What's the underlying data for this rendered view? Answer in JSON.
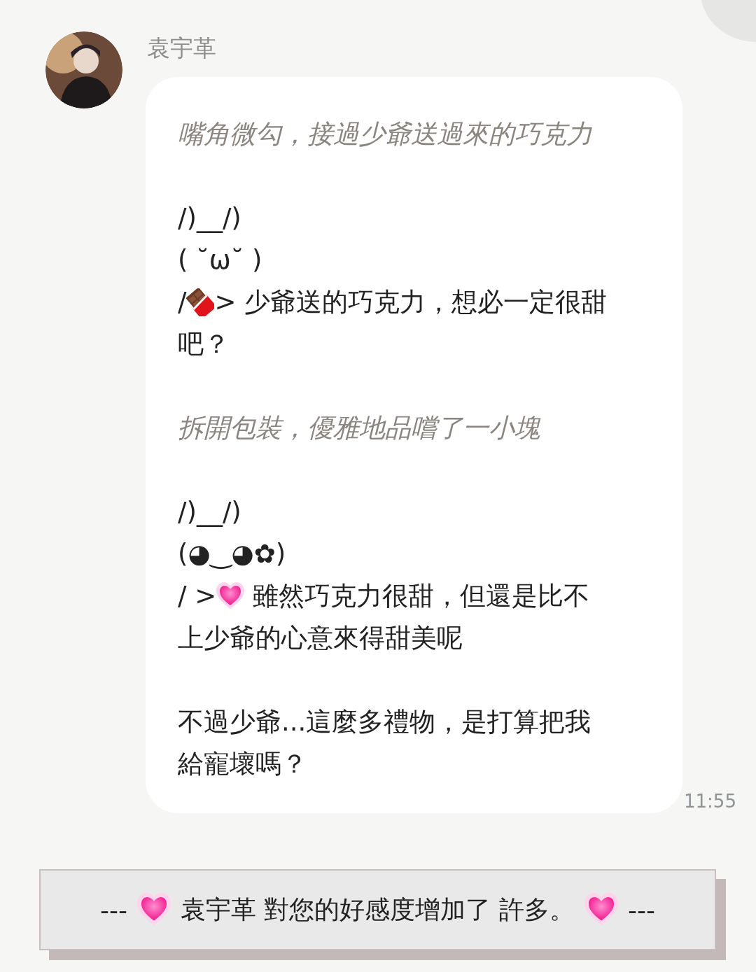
{
  "sender": {
    "name": "袁宇革"
  },
  "message": {
    "blocks": [
      {
        "kind": "action",
        "text": "嘴角微勾，接過少爺送過來的巧克力"
      },
      {
        "kind": "speech",
        "lines": [
          [
            {
              "kind": "text",
              "text": "/)__/)"
            }
          ],
          [
            {
              "kind": "text",
              "text": "( ˘ω˘ )"
            }
          ],
          [
            {
              "kind": "text",
              "text": "/"
            },
            {
              "kind": "chocolate"
            },
            {
              "kind": "text",
              "text": "> 少爺送的巧克力，想必一定很甜"
            }
          ],
          [
            {
              "kind": "text",
              "text": "吧？"
            }
          ]
        ]
      },
      {
        "kind": "action",
        "text": "拆開包裝，優雅地品嚐了一小塊"
      },
      {
        "kind": "speech",
        "lines": [
          [
            {
              "kind": "text",
              "text": "/)__/)"
            }
          ],
          [
            {
              "kind": "text",
              "text": "(◕‿◕✿)"
            }
          ],
          [
            {
              "kind": "text",
              "text": "/ >"
            },
            {
              "kind": "heart"
            },
            {
              "kind": "text",
              "text": " 雖然巧克力很甜，但還是比不"
            }
          ],
          [
            {
              "kind": "text",
              "text": "上少爺的心意來得甜美呢"
            }
          ]
        ]
      },
      {
        "kind": "speech",
        "lines": [
          [
            {
              "kind": "text",
              "text": "不過少爺...這麼多禮物，是打算把我"
            }
          ],
          [
            {
              "kind": "text",
              "text": "給寵壞嗎？"
            }
          ]
        ]
      }
    ],
    "time": "11:55"
  },
  "notice": {
    "segments": [
      {
        "kind": "text",
        "text": "---"
      },
      {
        "kind": "heart"
      },
      {
        "kind": "text",
        "text": "袁宇革 對您的好感度增加了 許多。"
      },
      {
        "kind": "heart"
      },
      {
        "kind": "text",
        "text": "---"
      }
    ]
  }
}
